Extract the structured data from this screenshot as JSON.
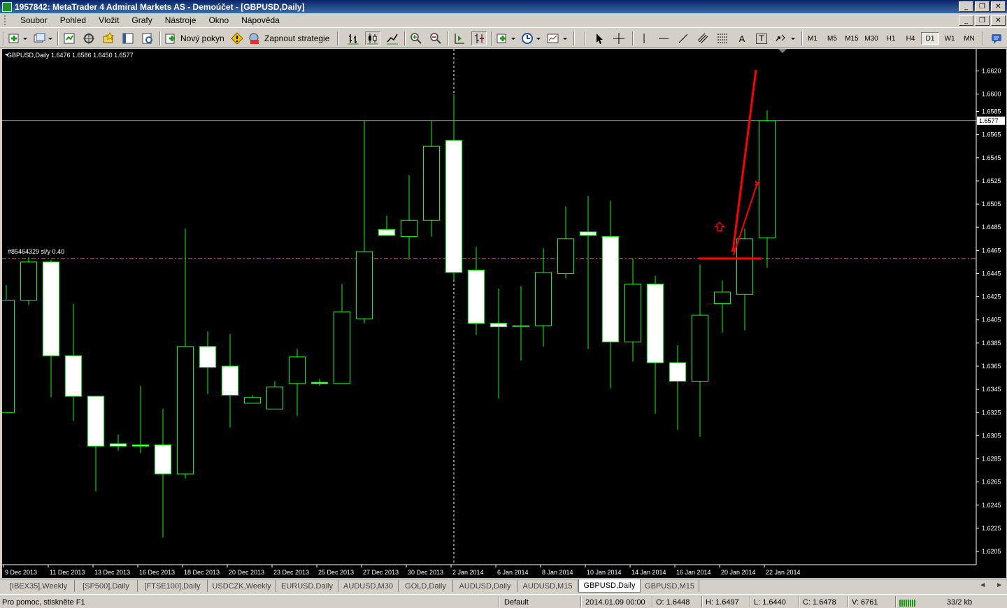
{
  "window": {
    "title": "1957842: MetaTrader 4 Admiral Markets AS - Demoúčet - [GBPUSD,Daily]",
    "min_glyph": "_",
    "max_glyph": "❐",
    "close_glyph": "✕"
  },
  "menu": [
    "Soubor",
    "Pohled",
    "Vložit",
    "Grafy",
    "Nástroje",
    "Okno",
    "Nápověda"
  ],
  "toolbar": {
    "new_order_label": "Nový pokyn",
    "strategy_label": "Zapnout strategie",
    "text_tool": "A",
    "text_label_tool": "T",
    "timeframes": [
      "M1",
      "M5",
      "M15",
      "M30",
      "H1",
      "H4",
      "D1",
      "W1",
      "MN"
    ],
    "active_timeframe": "D1"
  },
  "chart": {
    "symbol_header": "GBPUSD,Daily  1.6476 1.6586 1.6450 1.6577",
    "order_label": "#85464329 sl/y  0.40",
    "current_price_label": "1.6577",
    "colors": {
      "background": "#000000",
      "candle_outline": "#00ff00",
      "bull_body": "#000000",
      "bear_body": "#ffffff",
      "axis": "#ffffff",
      "order_line": "#ff6a3d",
      "drawing": "#ff0000",
      "price_line": "#c0c0c0"
    }
  },
  "chart_data": {
    "type": "candlestick",
    "title": "GBPUSD,Daily",
    "ylim": [
      1.6199,
      1.6633
    ],
    "y_ticks": [
      "1.6620",
      "1.6600",
      "1.6585",
      "1.6565",
      "1.6545",
      "1.6525",
      "1.6505",
      "1.6485",
      "1.6465",
      "1.6445",
      "1.6425",
      "1.6405",
      "1.6385",
      "1.6365",
      "1.6345",
      "1.6325",
      "1.6305",
      "1.6285",
      "1.6265",
      "1.6245",
      "1.6225",
      "1.6205"
    ],
    "x_ticks": [
      "9 Dec 2013",
      "11 Dec 2013",
      "13 Dec 2013",
      "16 Dec 2013",
      "18 Dec 2013",
      "20 Dec 2013",
      "23 Dec 2013",
      "25 Dec 2013",
      "27 Dec 2013",
      "30 Dec 2013",
      "2 Jan 2014",
      "6 Jan 2014",
      "8 Jan 2014",
      "10 Jan 2014",
      "14 Jan 2014",
      "16 Jan 2014",
      "20 Jan 2014",
      "22 Jan 2014"
    ],
    "x_tick_index": [
      0,
      2,
      4,
      6,
      8,
      10,
      12,
      14,
      16,
      18,
      20,
      22,
      24,
      26,
      28,
      30,
      32,
      34
    ],
    "candles": [
      {
        "o": 1.6325,
        "h": 1.6435,
        "l": 1.6325,
        "c": 1.6422
      },
      {
        "o": 1.6422,
        "h": 1.6459,
        "l": 1.6418,
        "c": 1.6455
      },
      {
        "o": 1.6455,
        "h": 1.6457,
        "l": 1.6338,
        "c": 1.6374
      },
      {
        "o": 1.6374,
        "h": 1.6419,
        "l": 1.6318,
        "c": 1.6339
      },
      {
        "o": 1.6339,
        "h": 1.6339,
        "l": 1.6257,
        "c": 1.6296
      },
      {
        "o": 1.6298,
        "h": 1.6306,
        "l": 1.6292,
        "c": 1.6296
      },
      {
        "o": 1.6297,
        "h": 1.6348,
        "l": 1.629,
        "c": 1.6296
      },
      {
        "o": 1.6297,
        "h": 1.6328,
        "l": 1.6217,
        "c": 1.6272
      },
      {
        "o": 1.6272,
        "h": 1.6484,
        "l": 1.6268,
        "c": 1.6382
      },
      {
        "o": 1.6382,
        "h": 1.6395,
        "l": 1.6341,
        "c": 1.6364
      },
      {
        "o": 1.6365,
        "h": 1.6393,
        "l": 1.6312,
        "c": 1.634
      },
      {
        "o": 1.6333,
        "h": 1.634,
        "l": 1.6333,
        "c": 1.6338
      },
      {
        "o": 1.6328,
        "h": 1.6352,
        "l": 1.6328,
        "c": 1.6347
      },
      {
        "o": 1.635,
        "h": 1.638,
        "l": 1.6322,
        "c": 1.6373
      },
      {
        "o": 1.6351,
        "h": 1.6354,
        "l": 1.6348,
        "c": 1.635
      },
      {
        "o": 1.635,
        "h": 1.6436,
        "l": 1.635,
        "c": 1.6412
      },
      {
        "o": 1.6406,
        "h": 1.6577,
        "l": 1.6402,
        "c": 1.6464
      },
      {
        "o": 1.6483,
        "h": 1.6495,
        "l": 1.6479,
        "c": 1.6478
      },
      {
        "o": 1.6477,
        "h": 1.653,
        "l": 1.6457,
        "c": 1.6491
      },
      {
        "o": 1.6491,
        "h": 1.6577,
        "l": 1.6477,
        "c": 1.6555
      },
      {
        "o": 1.656,
        "h": 1.66,
        "l": 1.644,
        "c": 1.6446
      },
      {
        "o": 1.6448,
        "h": 1.6468,
        "l": 1.6392,
        "c": 1.6402
      },
      {
        "o": 1.6402,
        "h": 1.6432,
        "l": 1.6337,
        "c": 1.6399
      },
      {
        "o": 1.6399,
        "h": 1.6434,
        "l": 1.637,
        "c": 1.64
      },
      {
        "o": 1.64,
        "h": 1.6467,
        "l": 1.6382,
        "c": 1.6446
      },
      {
        "o": 1.6445,
        "h": 1.6503,
        "l": 1.6441,
        "c": 1.6475
      },
      {
        "o": 1.6481,
        "h": 1.6512,
        "l": 1.638,
        "c": 1.6478
      },
      {
        "o": 1.6477,
        "h": 1.6508,
        "l": 1.6346,
        "c": 1.6386
      },
      {
        "o": 1.6386,
        "h": 1.6458,
        "l": 1.6369,
        "c": 1.6436
      },
      {
        "o": 1.6436,
        "h": 1.6443,
        "l": 1.6324,
        "c": 1.6368
      },
      {
        "o": 1.6368,
        "h": 1.6383,
        "l": 1.631,
        "c": 1.6352
      },
      {
        "o": 1.6352,
        "h": 1.6453,
        "l": 1.6304,
        "c": 1.6409
      },
      {
        "o": 1.6419,
        "h": 1.6439,
        "l": 1.6394,
        "c": 1.6429
      },
      {
        "o": 1.6427,
        "h": 1.6484,
        "l": 1.6396,
        "c": 1.6475
      },
      {
        "o": 1.6476,
        "h": 1.6586,
        "l": 1.645,
        "c": 1.6577
      }
    ],
    "current_price": 1.6577,
    "order_price": 1.6458,
    "grid": false
  },
  "tabs": {
    "items": [
      "[IBEX35],Weekly",
      "[SP500],Daily",
      "[FTSE100],Daily",
      "USDCZK,Weekly",
      "EURUSD,Daily",
      "AUDUSD,M30",
      "GOLD,Daily",
      "AUDUSD,Daily",
      "AUDUSD,M15",
      "GBPUSD,Daily",
      "GBPUSD,M15"
    ],
    "active": "GBPUSD,Daily",
    "left_arrow": "◄",
    "right_arrow": "►"
  },
  "status": {
    "help": "Pro pomoc, stiskněte F1",
    "profile": "Default",
    "datetime": "2014.01.09 00:00",
    "open": "O: 1.6448",
    "high": "H: 1.6497",
    "low": "L: 1.6440",
    "close": "C: 1.6478",
    "volume": "V: 6761",
    "traffic": "33/2 kb"
  }
}
